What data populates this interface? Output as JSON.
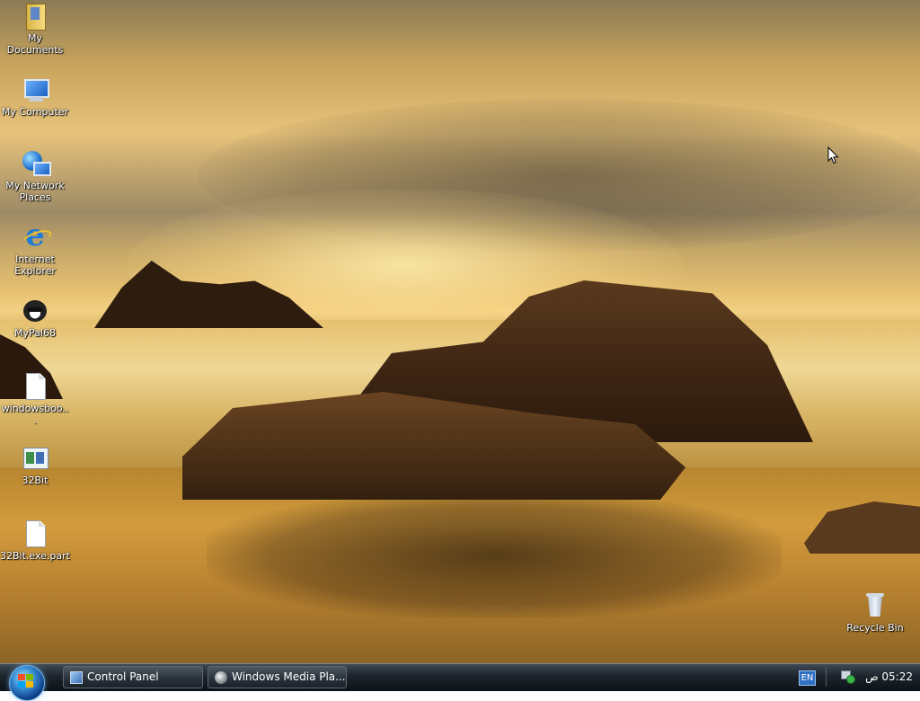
{
  "desktop": {
    "icons": [
      {
        "label": "My Documents",
        "icon": "my-documents-icon"
      },
      {
        "label": "My Computer",
        "icon": "my-computer-icon"
      },
      {
        "label": "My Network Places",
        "icon": "network-places-icon"
      },
      {
        "label": "Internet Explorer",
        "icon": "internet-explorer-icon"
      },
      {
        "label": "MyPal68",
        "icon": "mypal-browser-icon"
      },
      {
        "label": "windowsboo...",
        "icon": "blank-file-icon"
      },
      {
        "label": "32Bit",
        "icon": "application-icon"
      },
      {
        "label": "32Bit.exe.part",
        "icon": "blank-file-icon"
      }
    ],
    "recycle_bin": {
      "label": "Recycle Bin",
      "icon": "recycle-bin-icon"
    }
  },
  "taskbar": {
    "start_icon": "windows-flag-icon",
    "buttons": [
      {
        "label": "Control Panel",
        "icon": "control-panel-icon"
      },
      {
        "label": "Windows Media Pla...",
        "icon": "media-player-icon"
      }
    ],
    "tray": {
      "language": "EN",
      "network_icon": "network-status-icon",
      "clock": "05:22 ص"
    }
  }
}
